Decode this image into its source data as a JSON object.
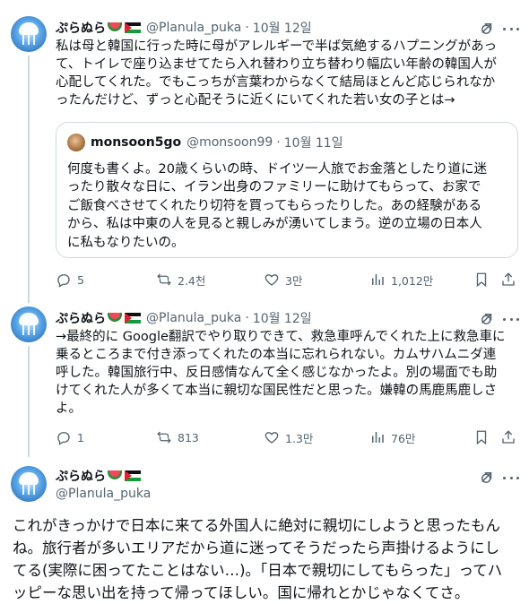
{
  "author": {
    "name": "ぷらぬら",
    "handle": "@Planula_puka"
  },
  "tweets": [
    {
      "date": "10월 12일",
      "separator": "·",
      "lines": [
        "私は母と韓国に行った時に母がアレルギーで半ば気絶するハプニングがあっ",
        "て、トイレで座り込ませてたら入れ替わり立ち替わり幅広い年齢の韓国人が",
        "心配してくれた。でもこっちが言葉わからなくて結局ほとんど応じられなか",
        "ったんだけど、ずっと心配そうに近くにいてくれた若い女の子とは→"
      ],
      "quote": {
        "name": "monsoon5go",
        "handle": "@monsoon99",
        "separator": "·",
        "date": "10월 11일",
        "lines": [
          "何度も書くよ。20歳くらいの時、ドイツ一人旅でお金落としたり道に迷",
          "ったり散々な日に、イラン出身のファミリーに助けてもらって、お家で",
          "ご飯食べさせてくれたり切符を買ってもらったりした。あの経験がある",
          "から、私は中東の人を見ると親しみが湧いてしまう。逆の立場の日本人",
          "に私もなりたいの。"
        ]
      },
      "replies": "5",
      "retweets": "2.4천",
      "likes": "3만",
      "views": "1,012만"
    },
    {
      "date": "10월 12일",
      "separator": "·",
      "lines": [
        "→最終的に Google翻訳でやり取りできて、救急車呼んでくれた上に救急車に",
        "乗るところまで付き添ってくれたの本当に忘れられない。カムサハムニダ連",
        "呼した。韓国旅行中、反日感情なんて全く感じなかったよ。別の場面でも助",
        "けてくれた人が多くて本当に親切な国民性だと思った。嫌韓の馬鹿馬鹿しさ",
        "よ。"
      ],
      "replies": "1",
      "retweets": "813",
      "likes": "1.3만",
      "views": "76만"
    }
  ],
  "main": {
    "lines": [
      "これがきっかけで日本に来てる外国人に絶対に親切にしようと思ったもん",
      "ね。旅行者が多いエリアだから道に迷ってそうだったら声掛けるようにし",
      "てる(実際に困ってたことはない…)。「日本で親切にしてもらった」ってハ",
      "ッピーな思い出を持って帰ってほしい。国に帰れとかじゃなくてさ。"
    ]
  },
  "icons": {
    "avatar": "jellyfish-avatar",
    "quote_avatar": "dog-avatar",
    "grok": "grok-icon",
    "more": "more-icon",
    "reply": "reply-icon",
    "retweet": "retweet-icon",
    "like": "heart-icon",
    "views": "views-icon",
    "bookmark": "bookmark-icon",
    "share": "share-icon"
  },
  "colors": {
    "text": "#0f1419",
    "secondary": "#536471",
    "border": "#cfd9de",
    "background": "#ffffff"
  }
}
